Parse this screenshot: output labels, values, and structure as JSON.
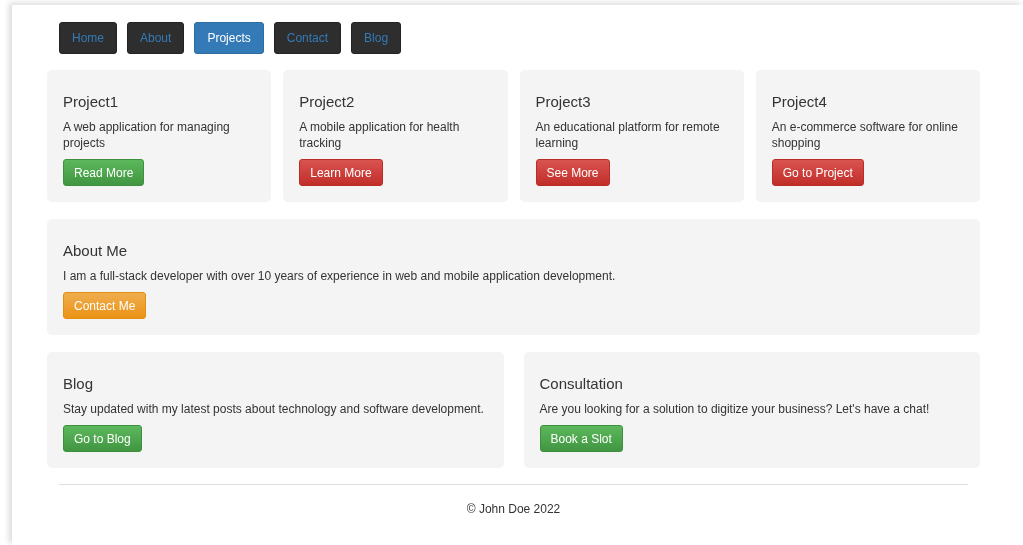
{
  "nav": [
    {
      "label": "Home",
      "selected": false
    },
    {
      "label": "About",
      "selected": false
    },
    {
      "label": "Projects",
      "selected": true
    },
    {
      "label": "Contact",
      "selected": false
    },
    {
      "label": "Blog",
      "selected": false
    }
  ],
  "projects": [
    {
      "title": "Project1",
      "description": "A web application for managing projects",
      "button": {
        "label": "Read More",
        "kind": "success"
      }
    },
    {
      "title": "Project2",
      "description": "A mobile application for health tracking",
      "button": {
        "label": "Learn More",
        "kind": "danger"
      }
    },
    {
      "title": "Project3",
      "description": "An educational platform for remote learning",
      "button": {
        "label": "See More",
        "kind": "danger"
      }
    },
    {
      "title": "Project4",
      "description": "An e-commerce software for online shopping",
      "button": {
        "label": "Go to Project",
        "kind": "danger"
      }
    }
  ],
  "about": {
    "title": "About Me",
    "text": "I am a full-stack developer with over 10 years of experience in web and mobile application development.",
    "button": {
      "label": "Contact Me",
      "kind": "warning"
    }
  },
  "panels": [
    {
      "title": "Blog",
      "text": "Stay updated with my latest posts about technology and software development.",
      "button": {
        "label": "Go to Blog",
        "kind": "success"
      }
    },
    {
      "title": "Consultation",
      "text": "Are you looking for a solution to digitize your business? Let's have a chat!",
      "button": {
        "label": "Book a Slot",
        "kind": "success"
      }
    }
  ],
  "footer": "© John Doe 2022"
}
